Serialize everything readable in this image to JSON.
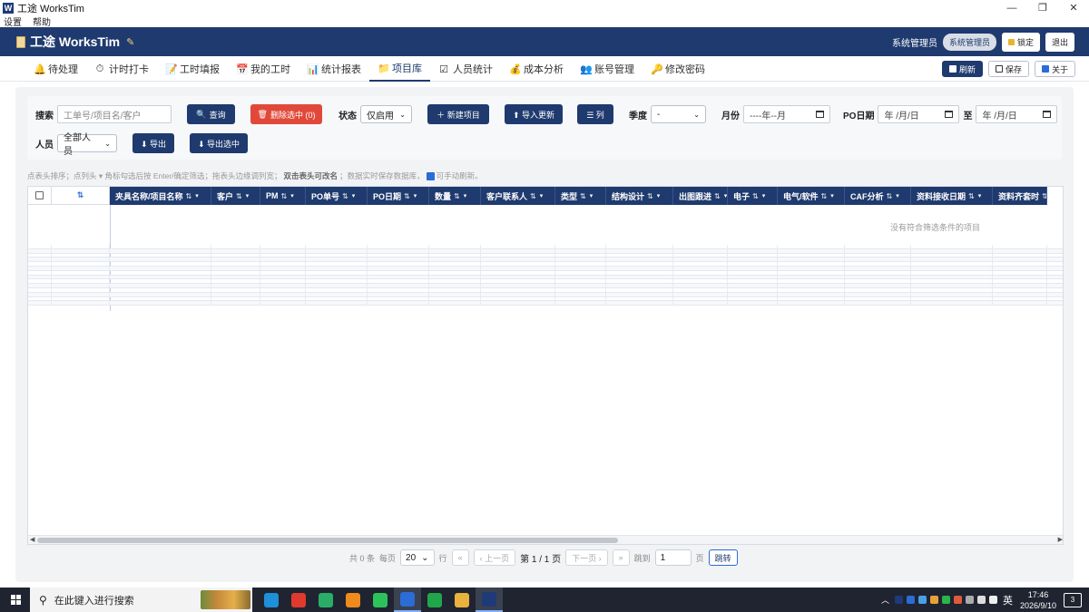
{
  "window": {
    "title": "工途 WorksTim",
    "app_icon_letter": "W",
    "minimize": "—",
    "restore": "❐",
    "close": "✕"
  },
  "menubar": {
    "items": [
      "设置",
      "帮助"
    ]
  },
  "header": {
    "brand": "工途 WorksTim",
    "brand_icon": "clipboard-icon",
    "user": "系统管理员",
    "role_badge": "系统管理员",
    "lock_label": "锁定",
    "logout_label": "退出",
    "color": "#1f3a6e"
  },
  "nav": {
    "tabs": [
      {
        "label": "待处理",
        "icon": "bell-icon",
        "glyph": "🔔"
      },
      {
        "label": "计时打卡",
        "icon": "stopwatch-icon",
        "glyph": "⏱"
      },
      {
        "label": "工时填报",
        "icon": "form-icon",
        "glyph": "📝"
      },
      {
        "label": "我的工时",
        "icon": "calendar-icon",
        "glyph": "📅"
      },
      {
        "label": "统计报表",
        "icon": "bar-chart-icon",
        "glyph": "📊"
      },
      {
        "label": "项目库",
        "icon": "folder-icon",
        "glyph": "📁"
      },
      {
        "label": "人员统计",
        "icon": "checklist-icon",
        "glyph": "☑"
      },
      {
        "label": "成本分析",
        "icon": "money-bag-icon",
        "glyph": "💰"
      },
      {
        "label": "账号管理",
        "icon": "users-icon",
        "glyph": "👥"
      },
      {
        "label": "修改密码",
        "icon": "key-icon",
        "glyph": "🔑"
      }
    ],
    "active_index": 5,
    "refresh_label": "刷新",
    "save_label": "保存",
    "about_label": "关于"
  },
  "filters": {
    "search_label": "搜索",
    "search_placeholder": "工单号/项目名/客户",
    "query_label": "查询",
    "delete_selected_label": "删除选中 (0)",
    "status_label": "状态",
    "status_value": "仅启用",
    "new_project_label": "＋ 新建项目",
    "import_update_label": "⬆ 导入更新",
    "columns_label": "☰ 列",
    "quarter_label": "季度",
    "quarter_value": "-",
    "month_label": "月份",
    "month_value": "----年--月",
    "po_date_label": "PO日期",
    "po_date_from": "年 /月/日",
    "to_label": "至",
    "po_date_to": "年 /月/日",
    "person_label": "人员",
    "person_value": "全部人员",
    "export_label": "⬇ 导出",
    "export_selected_label": "⬇ 导出选中"
  },
  "hint": {
    "part1": "点表头排序；点列头 ▾ 角标勾选后按 Enter/确定筛选；拖表头边缘调列宽；",
    "bold": "双击表头可改名",
    "part2": "；数据实时保存数据库，",
    "part3": "可手动刷新。"
  },
  "table": {
    "columns": [
      "夹具名称/项目名称",
      "客户",
      "PM",
      "PO单号",
      "PO日期",
      "数量",
      "客户联系人",
      "类型",
      "结构设计",
      "出图跟进",
      "电子",
      "电气/软件",
      "CAF分析",
      "资料接收日期",
      "资料齐套时"
    ],
    "sort_glyph": "⇅",
    "filter_glyph": "▾",
    "empty_message": "没有符合筛选条件的项目",
    "rows": []
  },
  "pager": {
    "total": "共 0 条",
    "per_page_label": "每页",
    "per_page_value": "20",
    "row_unit": "行",
    "first": "«",
    "prev": "‹ 上一页",
    "page_info": "第 1 / 1 页",
    "next": "下一页 ›",
    "last": "»",
    "jump_label": "跳到",
    "jump_value": "1",
    "page_unit": "页",
    "go_label": "跳转"
  },
  "taskbar": {
    "search_placeholder": "在此键入进行搜索",
    "apps": [
      "edge",
      "app-red",
      "wechat-work",
      "app-orange",
      "wechat",
      "feishu",
      "app-green",
      "file-explorer",
      "worktim"
    ],
    "ime": "英",
    "time": "17:46",
    "date": "2026/9/10",
    "notifications": "3"
  }
}
